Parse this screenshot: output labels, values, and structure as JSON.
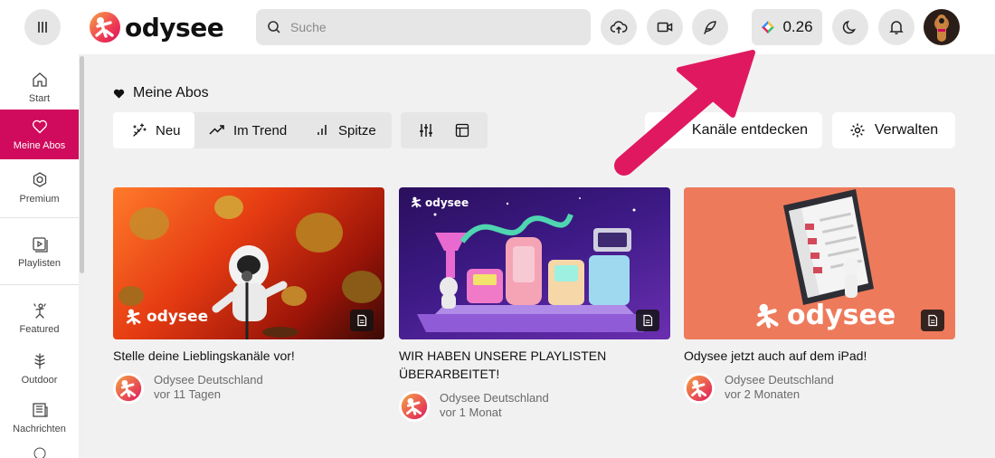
{
  "header": {
    "logo_text": "odysee",
    "search_placeholder": "Suche",
    "wallet_balance": "0.26"
  },
  "sidebar": {
    "items": [
      {
        "label": "Start",
        "icon": "home-icon"
      },
      {
        "label": "Meine Abos",
        "icon": "heart-icon",
        "active": true
      },
      {
        "label": "Premium",
        "icon": "premium-icon"
      },
      {
        "label": "Playlisten",
        "icon": "playlist-icon"
      },
      {
        "label": "Featured",
        "icon": "featured-icon"
      },
      {
        "label": "Outdoor",
        "icon": "tree-icon"
      },
      {
        "label": "Nachrichten",
        "icon": "newspaper-icon"
      }
    ]
  },
  "main": {
    "section_title": "Meine Abos",
    "tabs": [
      {
        "label": "Neu",
        "active": true
      },
      {
        "label": "Im Trend"
      },
      {
        "label": "Spitze"
      }
    ],
    "discover_label": "Kanäle entdecken",
    "manage_label": "Verwalten",
    "cards": [
      {
        "title": "Stelle deine Lieblingskanäle vor!",
        "channel": "Odysee Deutschland",
        "age": "vor 11 Tagen",
        "thumb_logo": "odysee"
      },
      {
        "title": "WIR HABEN UNSERE PLAYLISTEN ÜBERARBEITET!",
        "channel": "Odysee Deutschland",
        "age": "vor 1 Monat",
        "thumb_logo": "odysee"
      },
      {
        "title": "Odysee jetzt auch auf dem iPad!",
        "channel": "Odysee Deutschland",
        "age": "vor 2 Monaten",
        "thumb_logo": "odysee"
      }
    ]
  },
  "colors": {
    "brand": "#d00a5c",
    "arrow": "#e0185f",
    "background": "#f1f1f1"
  }
}
